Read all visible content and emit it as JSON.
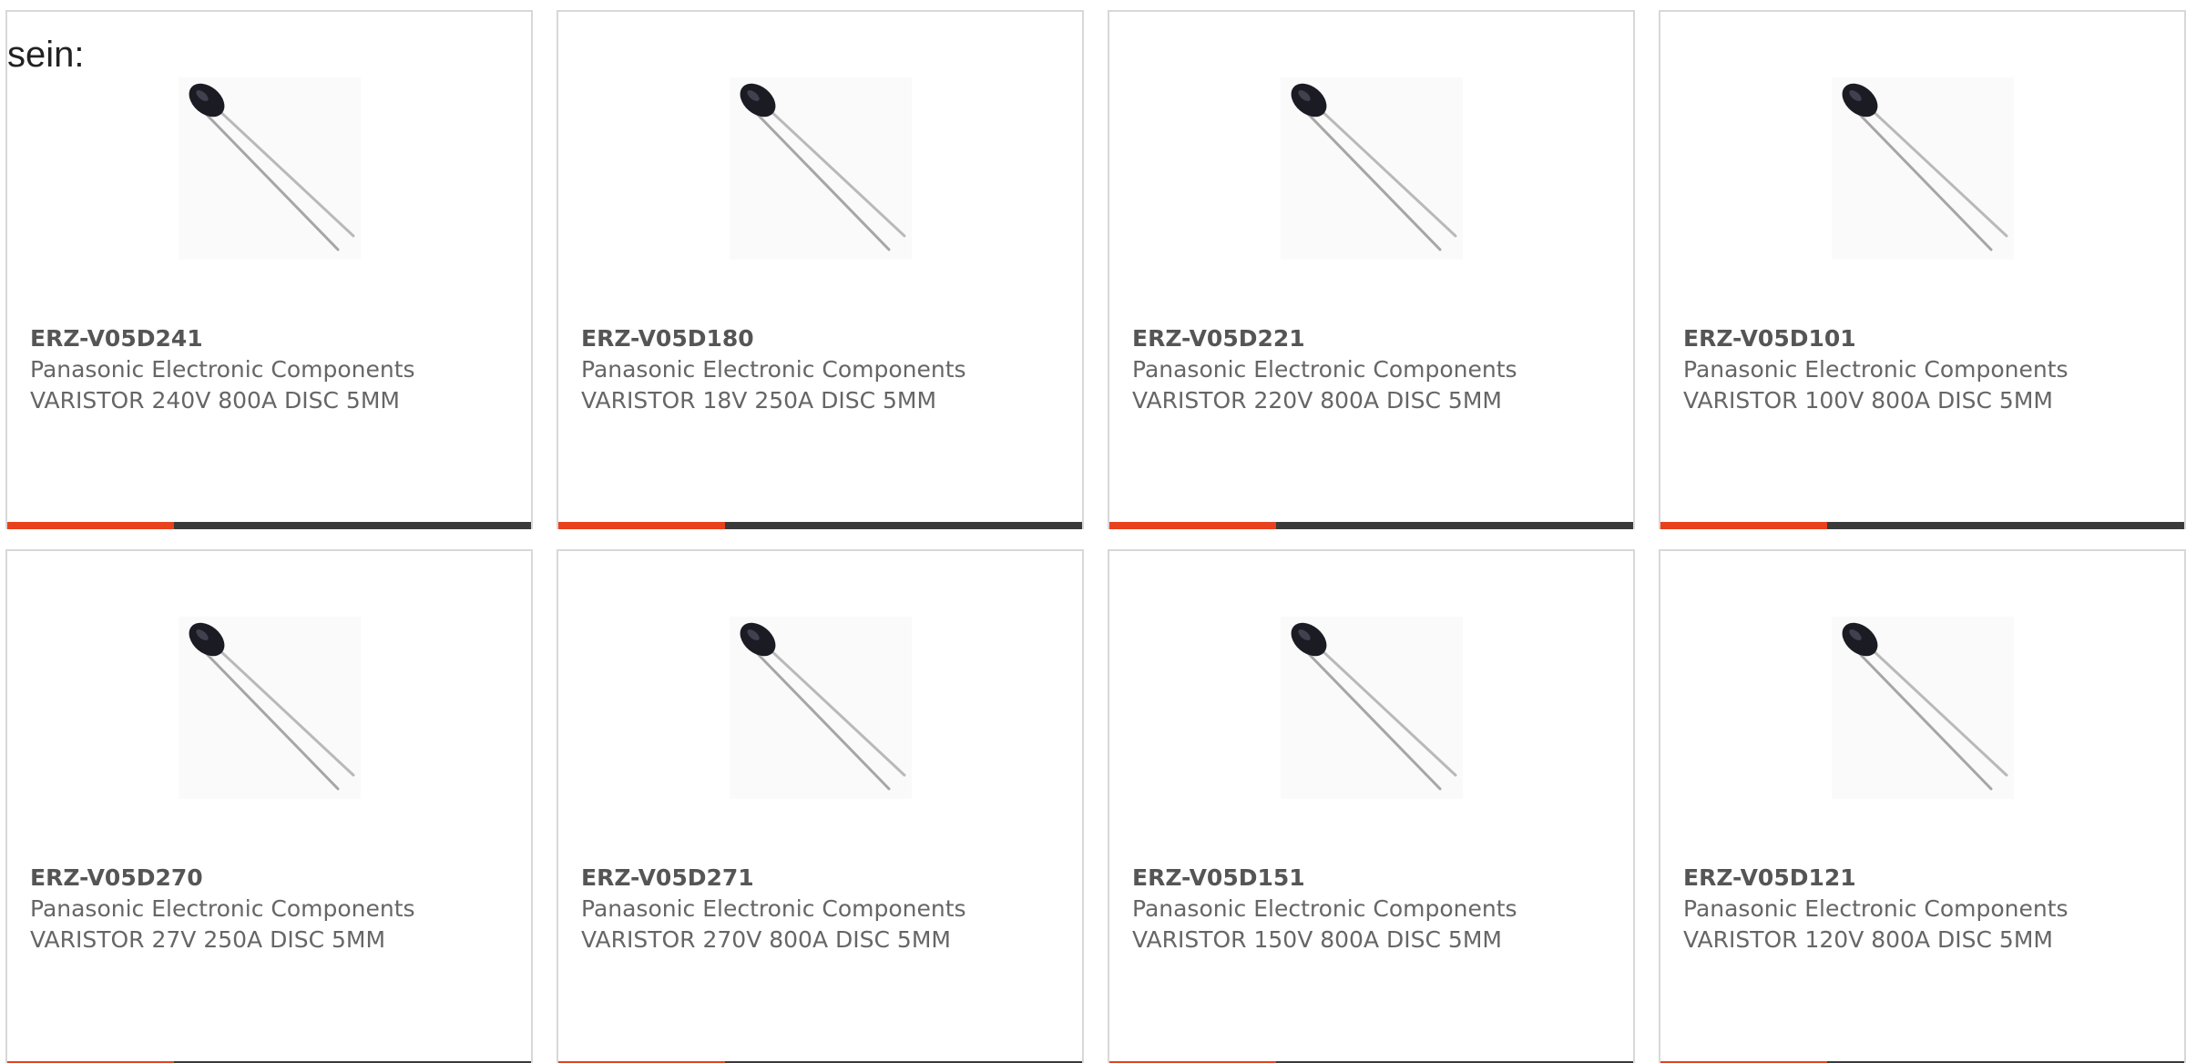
{
  "intro_text": "sein:",
  "colors": {
    "accent": "#e8411e",
    "bar_dark": "#3a3a3a",
    "text_gray": "#666666"
  },
  "products": [
    {
      "part": "ERZ-V05D241",
      "maker": "Panasonic Electronic Components",
      "desc": "VARISTOR 240V 800A DISC 5MM",
      "image_icon": "varistor-disc-icon"
    },
    {
      "part": "ERZ-V05D180",
      "maker": "Panasonic Electronic Components",
      "desc": "VARISTOR 18V 250A DISC 5MM",
      "image_icon": "varistor-disc-icon"
    },
    {
      "part": "ERZ-V05D221",
      "maker": "Panasonic Electronic Components",
      "desc": "VARISTOR 220V 800A DISC 5MM",
      "image_icon": "varistor-disc-icon"
    },
    {
      "part": "ERZ-V05D101",
      "maker": "Panasonic Electronic Components",
      "desc": "VARISTOR 100V 800A DISC 5MM",
      "image_icon": "varistor-disc-icon"
    },
    {
      "part": "ERZ-V05D270",
      "maker": "Panasonic Electronic Components",
      "desc": "VARISTOR 27V 250A DISC 5MM",
      "image_icon": "varistor-disc-icon"
    },
    {
      "part": "ERZ-V05D271",
      "maker": "Panasonic Electronic Components",
      "desc": "VARISTOR 270V 800A DISC 5MM",
      "image_icon": "varistor-disc-icon"
    },
    {
      "part": "ERZ-V05D151",
      "maker": "Panasonic Electronic Components",
      "desc": "VARISTOR 150V 800A DISC 5MM",
      "image_icon": "varistor-disc-icon"
    },
    {
      "part": "ERZ-V05D121",
      "maker": "Panasonic Electronic Components",
      "desc": "VARISTOR 120V 800A DISC 5MM",
      "image_icon": "varistor-disc-icon"
    }
  ]
}
